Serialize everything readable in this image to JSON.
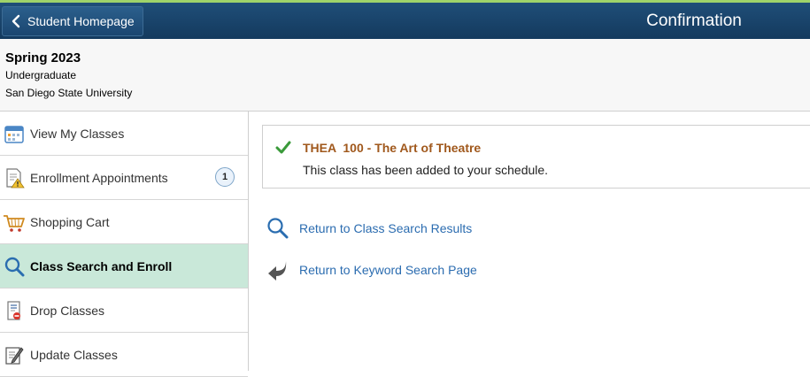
{
  "header": {
    "back_label": "Student Homepage",
    "title": "Confirmation"
  },
  "context": {
    "term": "Spring 2023",
    "career": "Undergraduate",
    "institution": "San Diego State University"
  },
  "sidebar": {
    "items": [
      {
        "label": "View My Classes",
        "icon": "calendar-icon"
      },
      {
        "label": "Enrollment Appointments",
        "icon": "document-warning-icon",
        "badge": "1"
      },
      {
        "label": "Shopping Cart",
        "icon": "shopping-cart-icon"
      },
      {
        "label": "Class Search and Enroll",
        "icon": "magnifier-icon",
        "active": true
      },
      {
        "label": "Drop Classes",
        "icon": "drop-document-icon"
      },
      {
        "label": "Update Classes",
        "icon": "edit-document-icon"
      }
    ]
  },
  "message": {
    "title": "THEA  100 - The Art of Theatre",
    "text": "This class has been added to your schedule."
  },
  "links": {
    "class_search": "Return to Class Search Results",
    "keyword_search": "Return to Keyword Search Page"
  },
  "colors": {
    "header_bg": "#1f4e78",
    "active_nav_bg": "#c9e8d9",
    "link": "#2b6cb0",
    "message_title": "#a0581c",
    "success_check": "#3a9a3a"
  }
}
